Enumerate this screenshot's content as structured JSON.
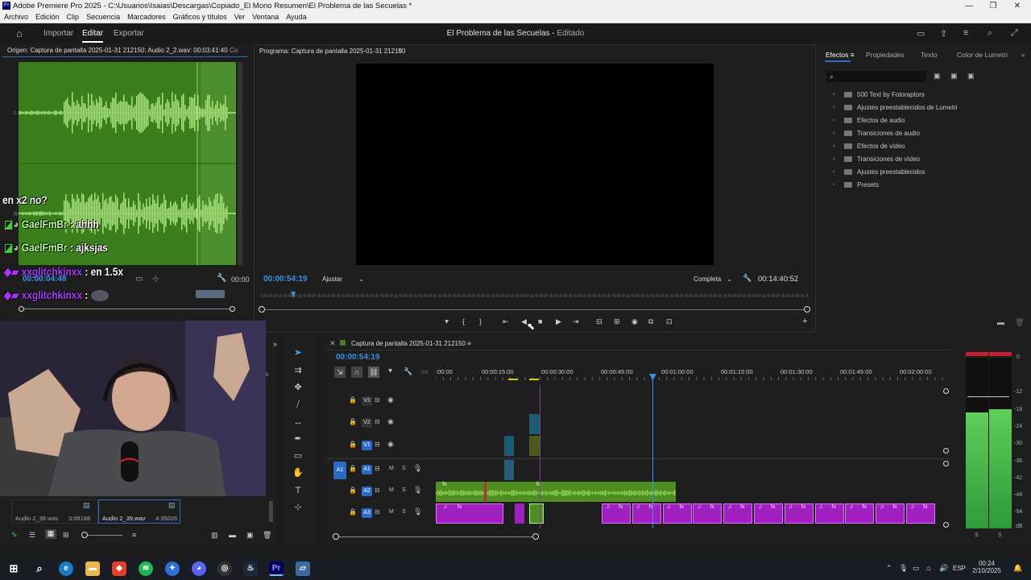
{
  "window": {
    "title": "Adobe Premiere Pro 2025 - C:\\Usuarios\\Isaias\\Descargas\\Copiado_El Mono Resumen\\El Problema de las Secuelas *",
    "app_icon": "Pr"
  },
  "menu": [
    "Archivo",
    "Edición",
    "Clip",
    "Secuencia",
    "Marcadores",
    "Gráficos y títulos",
    "Ver",
    "Ventana",
    "Ayuda"
  ],
  "workspace": {
    "tabs": [
      "Importar",
      "Editar",
      "Exportar"
    ],
    "active_tab": "Editar",
    "project_title": "El Problema de las Secuelas",
    "project_status": "Editado",
    "separator": "-"
  },
  "source_panel": {
    "title": "Origen: Captura de pantalla 2025-01-31 212150: Audio 2_2.wav: 00:03:41:40",
    "next_tab": "Co",
    "timecode": "00:00:04:48",
    "timecode_right": "00:00",
    "channel_labels": [
      "L",
      "L",
      "R",
      "R"
    ]
  },
  "chat": [
    {
      "user": "",
      "message": "en x2 no?"
    },
    {
      "user": "GaelFmBr",
      "message": ": ahhh"
    },
    {
      "user": "GaelFmBr",
      "message": ": ajksjas"
    },
    {
      "user": "xxglitchkinxx",
      "message": ": en 1.5x"
    },
    {
      "user": "xxglitchkinxx",
      "message": ":"
    }
  ],
  "program_panel": {
    "title": "Programa: Captura de pantalla 2025-01-31 212150",
    "timecode": "00:00:54:19",
    "fit_label": "Ajustar",
    "quality_label": "Completa",
    "duration": "00:14:40:52"
  },
  "effects_panel": {
    "tabs": [
      "Efectos",
      "Propiedades",
      "Texto",
      "Color de Lumetri"
    ],
    "active_tab": "Efectos",
    "items": [
      "500 Text by Fotoraptors",
      "Ajustes preestablecidos de Lumetri",
      "Efectos de audio",
      "Transiciones de audio",
      "Efectos de vídeo",
      "Transiciones de vídeo",
      "Ajustes preestablecidos",
      "Presets"
    ]
  },
  "project_bin": {
    "items": [
      {
        "name": "Audio 2_38.wav",
        "duration": "3:08188"
      },
      {
        "name": "Audio 2_39.wav",
        "duration": "4:35026"
      }
    ]
  },
  "timeline": {
    "sequence_name": "Captura de pantalla 2025-01-31 212150",
    "timecode": "00:00:54:19",
    "ruler": [
      ":00:00",
      "00:00:15:00",
      "00:00:30:00",
      "00:00:45:00",
      "00:01:00:00",
      "00:01:15:00",
      "00:01:30:00",
      "00:01:45:00",
      "00:02:00:00"
    ],
    "video_tracks": [
      "V3",
      "V2",
      "V1"
    ],
    "audio_tracks": [
      "A1",
      "A2",
      "A3"
    ],
    "source_patch_video": "V1",
    "source_patch_audio": "A1",
    "mute_label": "M",
    "solo_label": "S",
    "fx_label": "fx",
    "music_glyph": "♫"
  },
  "audio_meter": {
    "scale": [
      "0",
      "-12",
      "-18",
      "-24",
      "-30",
      "-36",
      "-42",
      "-48",
      "-54",
      "dB"
    ],
    "channel_labels": [
      "S",
      "S"
    ],
    "levels": [
      0.68,
      0.7
    ]
  },
  "taskbar": {
    "time": "00:24",
    "date": "2/10/2025",
    "language": "ESP"
  },
  "colors": {
    "accent_blue": "#2a6bc9",
    "timecode_blue": "#3b8fe8",
    "waveform_green": "#3a7f1c",
    "audio_clip_green": "#4f8f22",
    "audio_clip_purple": "#a020c0",
    "video_clip_teal": "#1f6f8f",
    "meter_green": "#3fae4a"
  }
}
